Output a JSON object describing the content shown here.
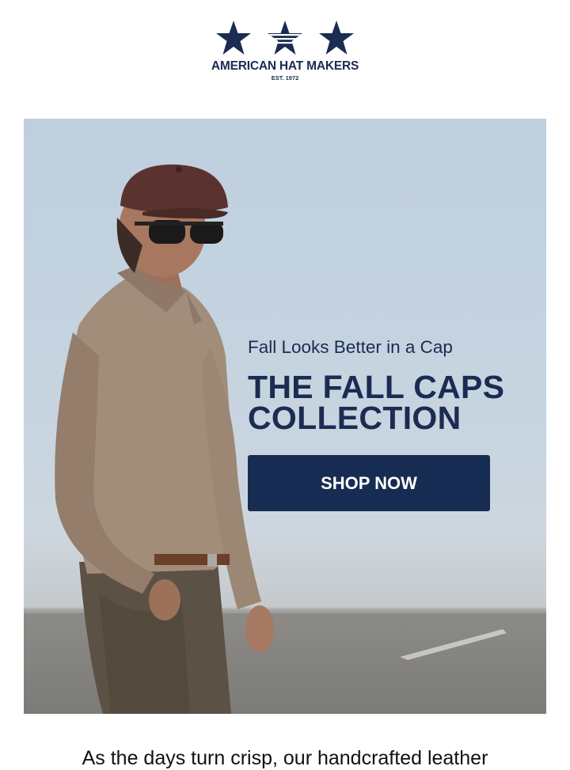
{
  "brand": {
    "name": "AMERICAN HAT MAKERS",
    "established": "EST. 1972",
    "logo_icons": [
      "star-icon",
      "striped-star-icon",
      "star-icon"
    ],
    "color": "#1b2c52"
  },
  "hero": {
    "subtitle": "Fall Looks Better in a Cap",
    "title_line1": "THE FALL CAPS",
    "title_line2": "COLLECTION",
    "cta_label": "SHOP NOW",
    "cta_color": "#172c52",
    "image": "man-wearing-leather-cap-photo"
  },
  "body": {
    "intro_text": "As the days turn crisp, our handcrafted leather"
  }
}
